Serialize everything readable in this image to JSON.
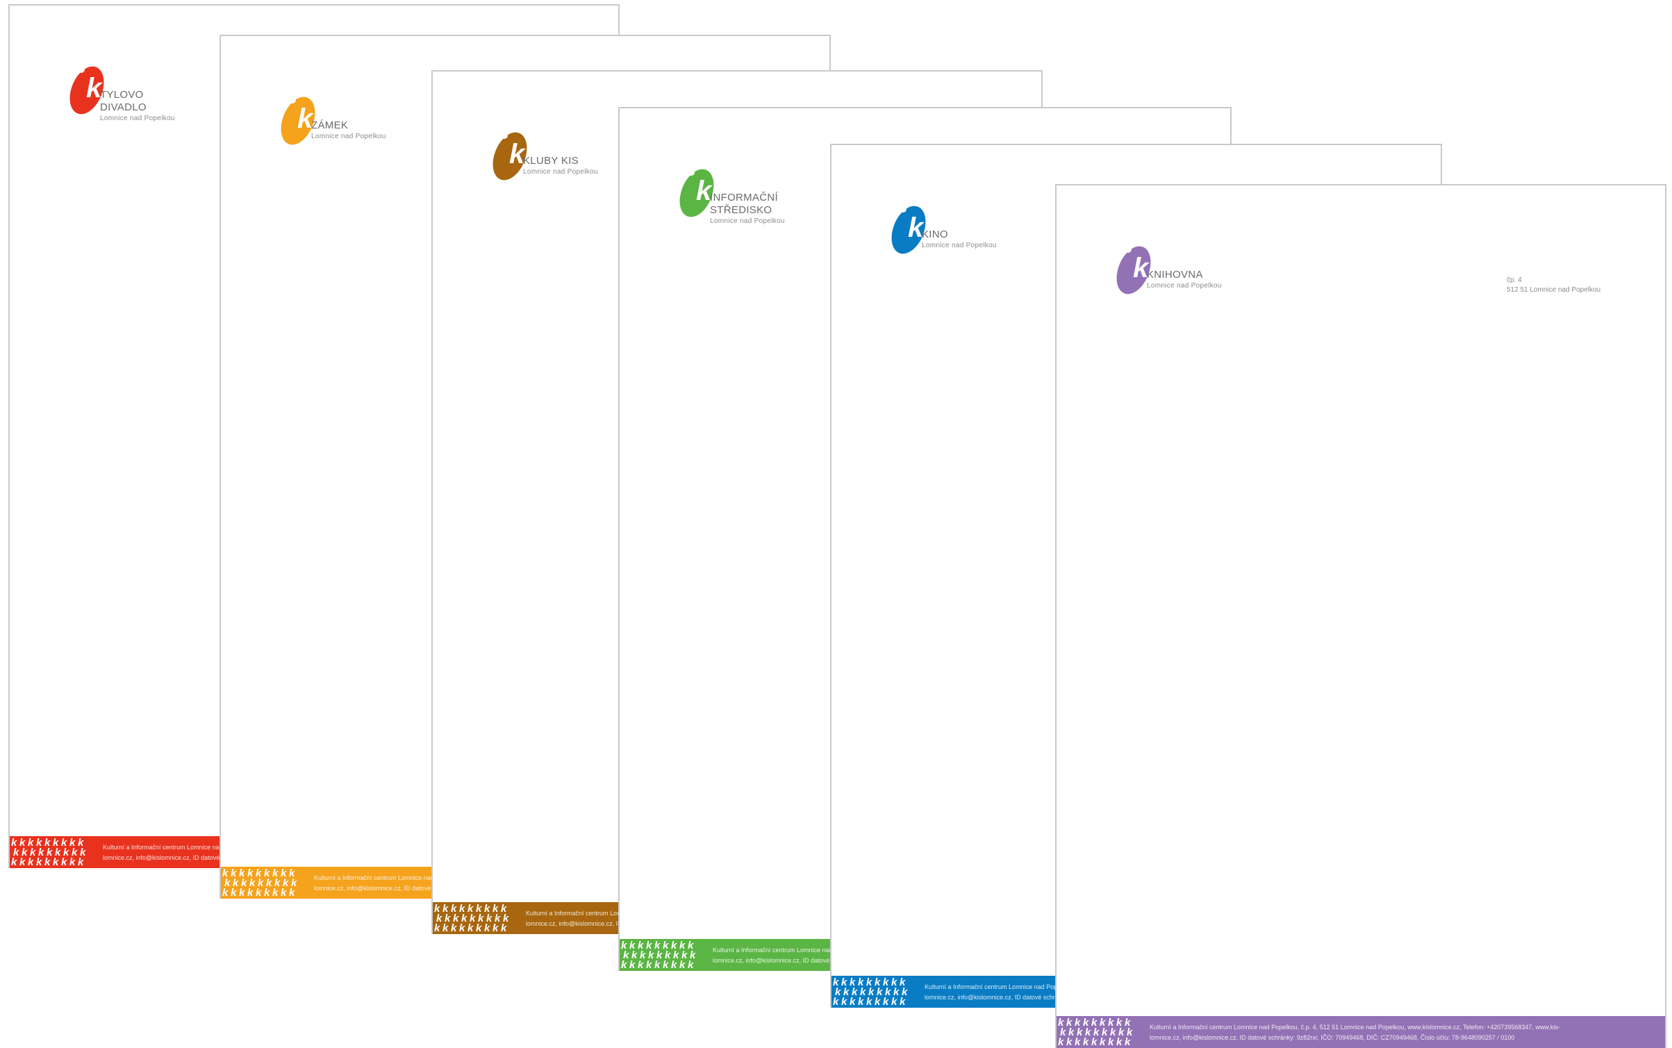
{
  "footer": {
    "line1": "Kulturní a Informační centrum Lomnice nad Popelkou, č.p. 4, 512 51 Lomnice nad Popelkou, www.kislomnice.cz, Telefon: +420739568347, www.kis-",
    "line2": "lomnice.cz, info@kislomnice.cz, ID datové schránky: 9z82rxr, IČO: 70949468, DIČ: CZ70949468, Číslo účtu: 78-9648090257 / 0100"
  },
  "address": {
    "line1": "čp. 4",
    "line2": "512 51 Lomnice nad Popelkou"
  },
  "sheets": [
    {
      "name_lines": [
        "TYLOVO",
        "DIVADLO"
      ],
      "place": "Lomnice nad Popelkou",
      "color": "#e8321e"
    },
    {
      "name_lines": [
        "ZÁMEK"
      ],
      "place": "Lomnice nad Popelkou",
      "color": "#f5a21c"
    },
    {
      "name_lines": [
        "KLUBY KIS"
      ],
      "place": "Lomnice nad Popelkou",
      "color": "#a7660f"
    },
    {
      "name_lines": [
        "INFORMAČNÍ",
        "STŘEDISKO"
      ],
      "place": "Lomnice nad Popelkou",
      "color": "#5bb544"
    },
    {
      "name_lines": [
        "KINO"
      ],
      "place": "Lomnice nad Popelkou",
      "color": "#0a7cc4"
    },
    {
      "name_lines": [
        "KNIHOVNA"
      ],
      "place": "Lomnice nad Popelkou",
      "color": "#9371b5"
    }
  ]
}
